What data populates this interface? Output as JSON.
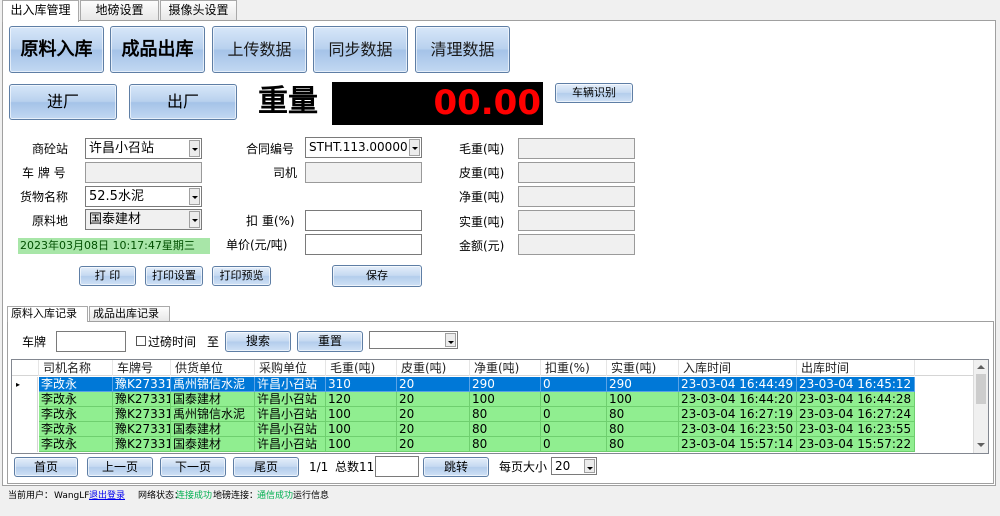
{
  "tabs": [
    "出入库管理",
    "地磅设置",
    "摄像头设置"
  ],
  "top_buttons": [
    "原料入库",
    "成品出库",
    "上传数据",
    "同步数据",
    "清理数据"
  ],
  "gate_buttons": {
    "in": "进厂",
    "out": "出厂"
  },
  "weight": {
    "label": "重量",
    "value": "00.00",
    "vehicle_recognition": "车辆识别"
  },
  "form": {
    "station_label": "商砼站",
    "station_value": "许昌小召站",
    "plate_label": "车 牌 号",
    "plate_value": "",
    "goods_label": "货物名称",
    "goods_value": "52.5水泥",
    "origin_label": "原料地",
    "origin_value": "国泰建材",
    "datetime": "2023年03月08日  10:17:47星期三",
    "contract_label": "合同编号",
    "contract_value": "STHT.113.00000",
    "driver_label": "司机",
    "driver_value": "",
    "deduct_label": "扣 重(%)",
    "deduct_value": "",
    "price_label": "单价(元/吨)",
    "price_value": "",
    "gross_label": "毛重(吨)",
    "gross_value": "",
    "tare_label": "皮重(吨)",
    "tare_value": "",
    "net_label": "净重(吨)",
    "net_value": "",
    "actual_label": "实重(吨)",
    "actual_value": "",
    "amount_label": "金额(元)",
    "amount_value": ""
  },
  "actions": {
    "print": "打  印",
    "print_settings": "打印设置",
    "print_preview": "打印预览",
    "save": "保存"
  },
  "record_tabs": [
    "原料入库记录",
    "成品出库记录"
  ],
  "filter": {
    "plate_label": "车牌",
    "plate_value": "",
    "weigh_time_label": "过磅时间",
    "to_label": "至",
    "search": "搜索",
    "reset": "重置",
    "select_value": ""
  },
  "table": {
    "columns": [
      "司机名称",
      "车牌号",
      "供货单位",
      "采购单位",
      "毛重(吨)",
      "皮重(吨)",
      "净重(吨)",
      "扣重(%)",
      "实重(吨)",
      "入库时间",
      "出库时间"
    ],
    "rows": [
      [
        "李改永",
        "豫K27331",
        "禹州锦信水泥",
        "许昌小召站",
        "310",
        "20",
        "290",
        "0",
        "290",
        "23-03-04  16:44:49",
        "23-03-04  16:45:12"
      ],
      [
        "李改永",
        "豫K27331",
        "国泰建材",
        "许昌小召站",
        "120",
        "20",
        "100",
        "0",
        "100",
        "23-03-04  16:44:20",
        "23-03-04  16:44:28"
      ],
      [
        "李改永",
        "豫K27331",
        "禹州锦信水泥",
        "许昌小召站",
        "100",
        "20",
        "80",
        "0",
        "80",
        "23-03-04  16:27:19",
        "23-03-04  16:27:24"
      ],
      [
        "李改永",
        "豫K27331",
        "国泰建材",
        "许昌小召站",
        "100",
        "20",
        "80",
        "0",
        "80",
        "23-03-04  16:23:50",
        "23-03-04  16:23:55"
      ],
      [
        "李改永",
        "豫K27331",
        "国泰建材",
        "许昌小召站",
        "100",
        "20",
        "80",
        "0",
        "80",
        "23-03-04  15:57:14",
        "23-03-04  15:57:22"
      ]
    ],
    "selected_indicator": "▸"
  },
  "pager": {
    "first": "首页",
    "prev": "上一页",
    "next": "下一页",
    "last": "尾页",
    "page_info": "1/1",
    "total_label": "总数11",
    "goto_value": "",
    "goto": "跳转",
    "page_size_label": "每页大小",
    "page_size_value": "20"
  },
  "status": {
    "user_label": "当前用户：",
    "user": "WangLF",
    "logout": "退出登录",
    "network_label": "网络状态：",
    "network_value": "连接成功",
    "scale_label": "地磅连接：",
    "scale_value": "通信成功",
    "run_info": "运行信息"
  },
  "colors": {
    "record_row": "#90ee90",
    "selected_row": "#0078d7",
    "weight_digits": "#ff0000",
    "datetime_bg": "#a8e6a8"
  }
}
